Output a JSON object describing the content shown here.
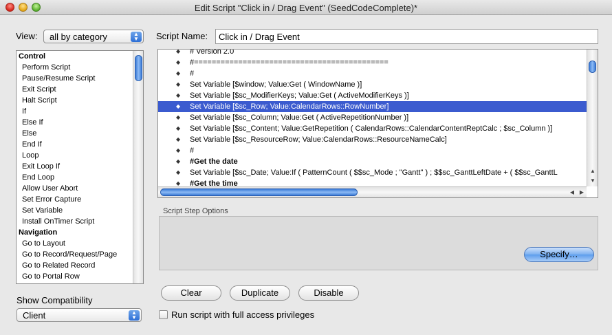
{
  "window": {
    "title": "Edit Script \"Click in / Drag Event\" (SeedCodeComplete)*"
  },
  "view": {
    "label": "View:",
    "selected": "all by category"
  },
  "script_name": {
    "label": "Script Name:",
    "value": "Click in / Drag Event"
  },
  "left_list": {
    "items": [
      {
        "label": "Control",
        "category": true
      },
      {
        "label": "Perform Script"
      },
      {
        "label": "Pause/Resume Script"
      },
      {
        "label": "Exit Script"
      },
      {
        "label": "Halt Script"
      },
      {
        "label": "If"
      },
      {
        "label": "Else If"
      },
      {
        "label": "Else"
      },
      {
        "label": "End If"
      },
      {
        "label": "Loop"
      },
      {
        "label": "Exit Loop If"
      },
      {
        "label": "End Loop"
      },
      {
        "label": "Allow User Abort"
      },
      {
        "label": "Set Error Capture"
      },
      {
        "label": "Set Variable"
      },
      {
        "label": "Install OnTimer Script"
      },
      {
        "label": "Navigation",
        "category": true
      },
      {
        "label": "Go to Layout"
      },
      {
        "label": "Go to Record/Request/Page"
      },
      {
        "label": "Go to Related Record"
      },
      {
        "label": "Go to Portal Row"
      }
    ],
    "scroll_position": 0.05
  },
  "script_lines": [
    {
      "text": "#   Version           2.0",
      "bold": false
    },
    {
      "text": "#============================================",
      "bold": false
    },
    {
      "text": "#",
      "bold": false
    },
    {
      "text": "Set Variable [$window; Value:Get ( WindowName )]",
      "bold": false
    },
    {
      "text": "Set Variable [$sc_ModifierKeys; Value:Get ( ActiveModifierKeys )]",
      "bold": false
    },
    {
      "text": "Set Variable [$sc_Row; Value:CalendarRows::RowNumber]",
      "bold": false,
      "selected": true
    },
    {
      "text": "Set Variable [$sc_Column; Value:Get ( ActiveRepetitionNumber )]",
      "bold": false
    },
    {
      "text": "Set Variable [$sc_Content; Value:GetRepetition ( CalendarRows::CalendarContentReptCalc ; $sc_Column )]",
      "bold": false
    },
    {
      "text": "Set Variable [$sc_ResourceRow; Value:CalendarRows::ResourceNameCalc]",
      "bold": false
    },
    {
      "text": "#",
      "bold": false
    },
    {
      "text": "#Get the date",
      "bold": true
    },
    {
      "text": "Set Variable [$sc_Date; Value:If ( PatternCount ( $$sc_Mode ; \"Gantt\" ) ;   $$sc_GanttLeftDate + ( $$sc_GanttL",
      "bold": false
    },
    {
      "text": "#Get the time",
      "bold": true
    }
  ],
  "options": {
    "label": "Script Step Options",
    "specify_label": "Specify…"
  },
  "buttons": {
    "clear": "Clear",
    "duplicate": "Duplicate",
    "disable": "Disable"
  },
  "compatibility": {
    "label": "Show Compatibility",
    "selected": "Client"
  },
  "full_access": {
    "label": "Run script with full access privileges",
    "checked": false
  }
}
